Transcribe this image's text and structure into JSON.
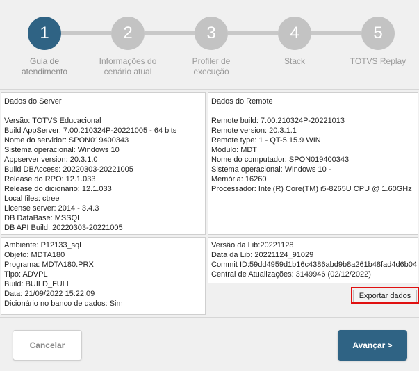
{
  "stepper": {
    "steps": [
      {
        "number": "1",
        "label_line1": "Guia de",
        "label_line2": "atendimento",
        "active": true
      },
      {
        "number": "2",
        "label_line1": "Informações do",
        "label_line2": "cenário atual",
        "active": false
      },
      {
        "number": "3",
        "label_line1": "Profiler de",
        "label_line2": "execução",
        "active": false
      },
      {
        "number": "4",
        "label_line1": "Stack",
        "label_line2": "",
        "active": false
      },
      {
        "number": "5",
        "label_line1": "TOTVS Replay",
        "label_line2": "",
        "active": false
      }
    ],
    "active_color": "#2f6384",
    "inactive_color": "#c3c3c3"
  },
  "server": {
    "title": "Dados do Server",
    "lines": [
      "Versão: TOTVS Educacional",
      "Build AppServer: 7.00.210324P-20221005 - 64 bits",
      "Nome do servidor: SPON019400343",
      "Sistema operacional: Windows 10",
      "Appserver version: 20.3.1.0",
      "Build DBAccess: 20220303-20221005",
      "Release do RPO:  12.1.033",
      "Release do dicionário: 12.1.033",
      "Local files: ctree",
      "License server: 2014 - 3.4.3",
      "DB DataBase: MSSQL",
      "DB API Build: 20220303-20221005"
    ]
  },
  "remote": {
    "title": "Dados do Remote",
    "lines": [
      "Remote build: 7.00.210324P-20221013",
      "Remote version: 20.3.1.1",
      "Remote type: 1 - QT-5.15.9 WIN",
      "Módulo: MDT",
      "Nome do computador: SPON019400343",
      "Sistema operacional: Windows 10 -",
      "Memória: 16260",
      "Processador: Intel(R) Core(TM) i5-8265U CPU @ 1.60GHz"
    ]
  },
  "environment": {
    "lines": [
      "Ambiente: P12133_sql",
      "Objeto: MDTA180",
      "Programa: MDTA180.PRX",
      "Tipo: ADVPL",
      "Build: BUILD_FULL",
      "Data: 21/09/2022 15:22:09",
      "Dicionário no banco de dados: Sim"
    ]
  },
  "lib": {
    "lines": [
      "Versão da Lib:20221128",
      "Data da Lib: 20221124_91029",
      "Commit ID:59dd4959d1b16c4386abd9b8a261b48fad4d6b04",
      "Central de Atualizações: 3149946 (02/12/2022)"
    ]
  },
  "actions": {
    "export_label": "Exportar dados",
    "cancel_label": "Cancelar",
    "next_label": "Avançar >",
    "highlight_color": "#e01010"
  }
}
